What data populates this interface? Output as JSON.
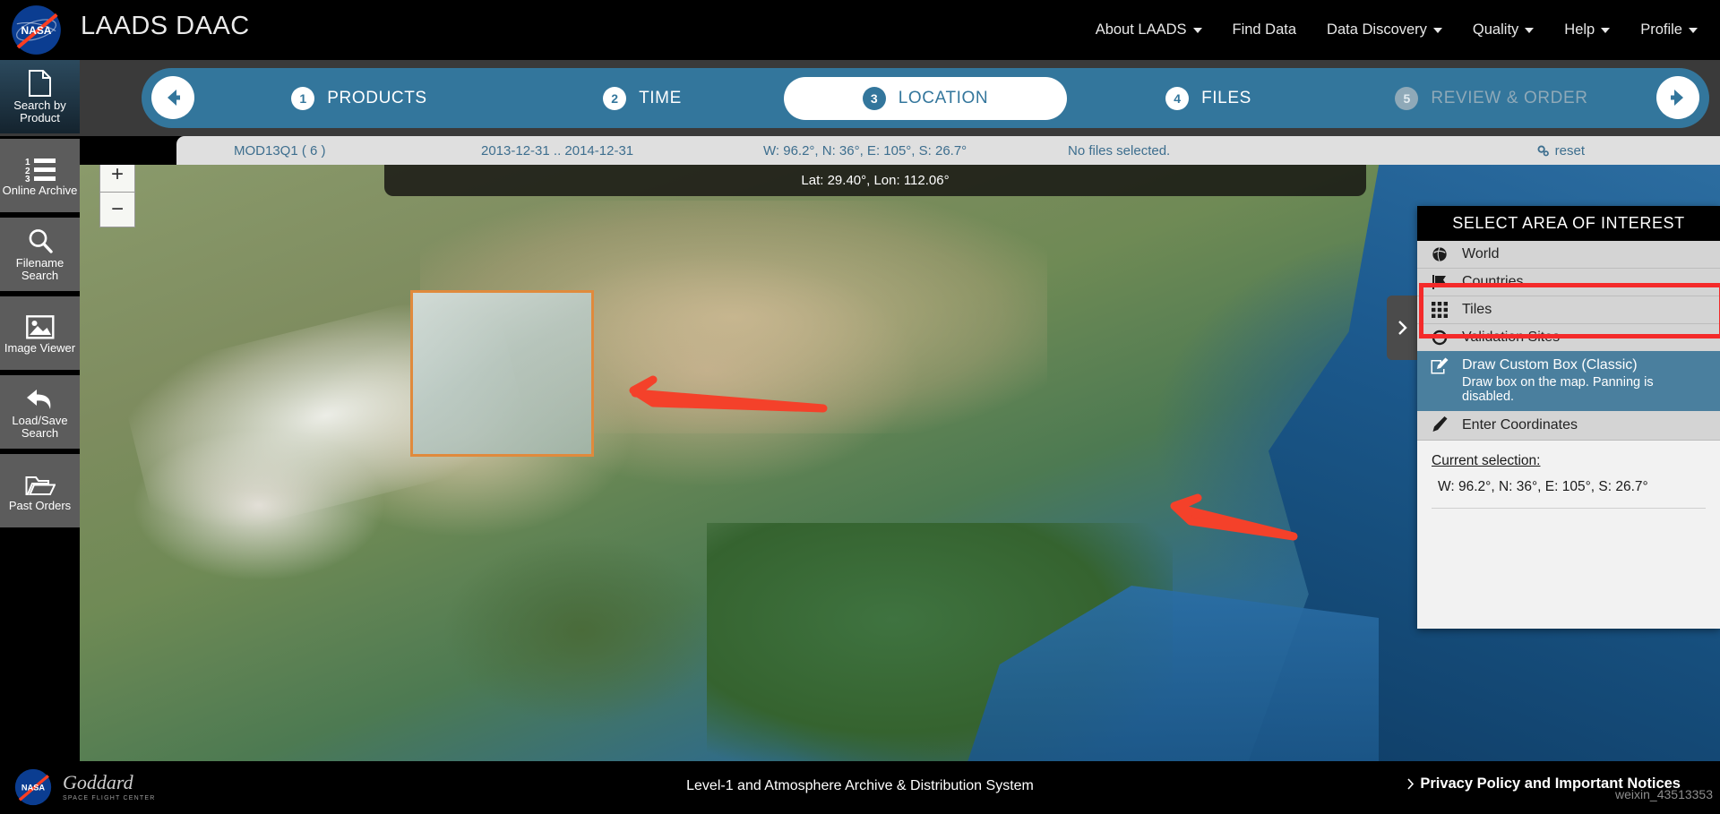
{
  "header": {
    "brand": "LAADS DAAC",
    "logo_alt": "nasa-meatball-logo",
    "nav": [
      {
        "label": "About LAADS",
        "has_caret": true
      },
      {
        "label": "Find Data",
        "has_caret": false
      },
      {
        "label": "Data Discovery",
        "has_caret": true
      },
      {
        "label": "Quality",
        "has_caret": true
      },
      {
        "label": "Help",
        "has_caret": true
      },
      {
        "label": "Profile",
        "has_caret": true
      }
    ]
  },
  "steps": {
    "back_icon": "arrow-left-icon",
    "forward_icon": "arrow-right-icon",
    "items": [
      {
        "num": "1",
        "label": "PRODUCTS",
        "state": "done"
      },
      {
        "num": "2",
        "label": "TIME",
        "state": "done"
      },
      {
        "num": "3",
        "label": "LOCATION",
        "state": "active"
      },
      {
        "num": "4",
        "label": "FILES",
        "state": "done"
      },
      {
        "num": "5",
        "label": "REVIEW & ORDER",
        "state": "disabled"
      }
    ]
  },
  "summary": {
    "product": "MOD13Q1 ( 6 )",
    "time": "2013-12-31 .. 2014-12-31",
    "location": "W: 96.2°, N: 36°, E: 105°, S: 26.7°",
    "files": "No files selected.",
    "reset_label": "reset",
    "reset_icon": "gears-icon"
  },
  "map": {
    "coord_readout": "Lat: 29.40°, Lon: 112.06°",
    "zoom_in": "+",
    "zoom_out": "−",
    "selection_box_name": "custom-aoi-box",
    "annotation_color": "#f4412a"
  },
  "aoi_panel": {
    "title": "SELECT AREA OF INTEREST",
    "options": [
      {
        "label": "World",
        "icon": "globe-icon"
      },
      {
        "label": "Countries",
        "icon": "flag-icon"
      },
      {
        "label": "Tiles",
        "icon": "grid-icon"
      },
      {
        "label": "Validation Sites",
        "icon": "circle-icon"
      }
    ],
    "draw_option": {
      "title": "Draw Custom Box (Classic)",
      "subtitle": "Draw box on the map. Panning is disabled.",
      "icon": "pencil-square-icon",
      "highlight_color": "#f42a2a",
      "selected_color": "#4a7f9e"
    },
    "enter_coordinates": {
      "label": "Enter Coordinates",
      "icon": "pencil-icon"
    },
    "current_selection_label": "Current selection:",
    "current_selection_value": "W: 96.2°, N: 36°, E: 105°, S: 26.7°",
    "collapse_icon": "chevron-right-icon"
  },
  "sidebar": {
    "items": [
      {
        "label": "Search by Product",
        "icon": "document-icon",
        "active": true
      },
      {
        "label": "Online Archive",
        "icon": "numbered-list-icon",
        "active": false
      },
      {
        "label": "Filename Search",
        "icon": "magnifier-icon",
        "active": false
      },
      {
        "label": "Image Viewer",
        "icon": "picture-icon",
        "active": false
      },
      {
        "label": "Load/Save Search",
        "icon": "undo-arrow-icon",
        "active": false
      },
      {
        "label": "Past Orders",
        "icon": "folder-open-icon",
        "active": false
      }
    ]
  },
  "footer": {
    "goddard_text": "Goddard",
    "goddard_sub": "SPACE FLIGHT CENTER",
    "center_text": "Level-1 and Atmosphere Archive & Distribution System",
    "right_link": "Privacy Policy and Important Notices",
    "right_icon": "chevron-right-icon",
    "watermark": "weixin_43513353"
  }
}
